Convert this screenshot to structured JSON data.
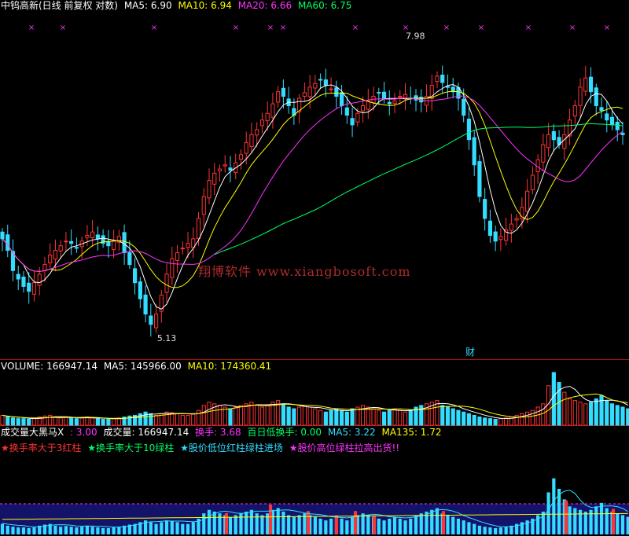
{
  "header": {
    "title": "中钨高新(日线 前复权 对数)",
    "ma5": "MA5: 6.90",
    "ma10": "MA10: 6.94",
    "ma20": "MA20: 6.66",
    "ma60": "MA60: 6.75"
  },
  "volume_header": {
    "volume": "VOLUME: 166947.14",
    "ma5": "MA5: 145966.00",
    "ma10": "MA10: 174360.41"
  },
  "indicator_header": {
    "name": "成交量大黑马X",
    "param": ": 3.00",
    "vol": "成交量: 166947.14",
    "turnover": "换手: 3.68",
    "low100": "百日低换手: 0.00",
    "ma5": "MA5: 3.22",
    "ma135": "MA135: 1.72"
  },
  "indicator_legend": {
    "l1": "★换手率大于3红柱",
    "l2": "★换手率大于10绿柱",
    "l3": "★股价低位红柱绿柱进场",
    "l4": "★股价高位绿柱拉高出货!!"
  },
  "annotations": {
    "high": "7.98",
    "low": "5.13",
    "cai": "财"
  },
  "watermark": "翔博软件 www.xiangbosoft.com",
  "colors": {
    "up": "#ff3333",
    "down": "#33ddff",
    "ma5": "#ffffff",
    "ma10": "#ffff00",
    "ma20": "#ff33ff",
    "ma60": "#00ff66",
    "grid": "#aa1111",
    "band": "#1a1a8c"
  },
  "chart_data": {
    "type": "candlestick",
    "axis": "log",
    "price_range": [
      5.0,
      8.2
    ],
    "highest": 7.98,
    "lowest": 5.13,
    "closes": [
      5.92,
      5.82,
      5.65,
      5.58,
      5.52,
      5.48,
      5.55,
      5.62,
      5.7,
      5.78,
      5.82,
      5.86,
      5.9,
      5.88,
      5.84,
      5.9,
      5.95,
      5.98,
      5.92,
      5.88,
      5.86,
      5.9,
      5.94,
      5.8,
      5.7,
      5.55,
      5.42,
      5.3,
      5.22,
      5.3,
      5.45,
      5.62,
      5.75,
      5.8,
      5.84,
      5.88,
      5.92,
      6.1,
      6.3,
      6.45,
      6.52,
      6.56,
      6.6,
      6.55,
      6.62,
      6.7,
      6.82,
      6.9,
      6.95,
      7.05,
      7.12,
      7.22,
      7.35,
      7.3,
      7.2,
      7.1,
      7.28,
      7.34,
      7.4,
      7.44,
      7.48,
      7.42,
      7.38,
      7.3,
      7.2,
      7.1,
      7.0,
      7.12,
      7.2,
      7.25,
      7.3,
      7.34,
      7.28,
      7.22,
      7.25,
      7.3,
      7.32,
      7.28,
      7.26,
      7.24,
      7.3,
      7.42,
      7.52,
      7.45,
      7.4,
      7.35,
      7.28,
      7.1,
      6.85,
      6.6,
      6.3,
      6.1,
      5.95,
      5.9,
      5.94,
      6.0,
      6.05,
      6.1,
      6.2,
      6.35,
      6.5,
      6.65,
      6.8,
      6.9,
      6.85,
      6.8,
      6.9,
      7.05,
      7.2,
      7.4,
      7.5,
      7.35,
      7.2,
      7.15,
      7.05,
      7.0,
      6.95,
      6.9
    ],
    "volumes": [
      0.3,
      0.25,
      0.22,
      0.2,
      0.2,
      0.18,
      0.2,
      0.25,
      0.28,
      0.3,
      0.25,
      0.22,
      0.24,
      0.22,
      0.2,
      0.22,
      0.25,
      0.22,
      0.2,
      0.18,
      0.18,
      0.2,
      0.22,
      0.25,
      0.28,
      0.3,
      0.35,
      0.4,
      0.35,
      0.3,
      0.35,
      0.4,
      0.38,
      0.35,
      0.3,
      0.3,
      0.35,
      0.45,
      0.6,
      0.7,
      0.65,
      0.6,
      0.55,
      0.5,
      0.55,
      0.6,
      0.65,
      0.7,
      0.6,
      0.55,
      0.6,
      0.7,
      0.75,
      0.65,
      0.55,
      0.5,
      0.55,
      0.6,
      0.55,
      0.5,
      0.45,
      0.4,
      0.45,
      0.5,
      0.45,
      0.4,
      0.5,
      0.55,
      0.6,
      0.55,
      0.5,
      0.45,
      0.4,
      0.45,
      0.5,
      0.45,
      0.4,
      0.45,
      0.55,
      0.6,
      0.65,
      0.7,
      0.75,
      0.6,
      0.55,
      0.5,
      0.45,
      0.4,
      0.35,
      0.3,
      0.25,
      0.22,
      0.2,
      0.18,
      0.2,
      0.22,
      0.25,
      0.3,
      0.35,
      0.4,
      0.45,
      0.55,
      0.65,
      1.2,
      1.6,
      1.3,
      1.0,
      0.8,
      0.75,
      0.7,
      0.65,
      0.7,
      0.8,
      0.9,
      0.75,
      0.65,
      0.6,
      0.55,
      0.5
    ],
    "ma_labels": [
      "MA5",
      "MA10",
      "MA20",
      "MA60"
    ],
    "ma_values": [
      6.9,
      6.94,
      6.66,
      6.75
    ],
    "volume_last": 166947.14,
    "volume_ma5": 145966.0,
    "volume_ma10": 174360.41,
    "turnover": 3.68,
    "turnover_ma5": 3.22,
    "turnover_ma135": 1.72,
    "signal_markers": [
      10,
      20,
      49,
      75,
      86,
      90,
      113,
      129,
      142,
      153,
      168,
      182,
      193
    ],
    "red_bars": [
      72,
      86,
      98,
      107,
      113,
      119,
      141,
      180,
      195
    ],
    "green_bars": [
      186,
      197
    ]
  }
}
